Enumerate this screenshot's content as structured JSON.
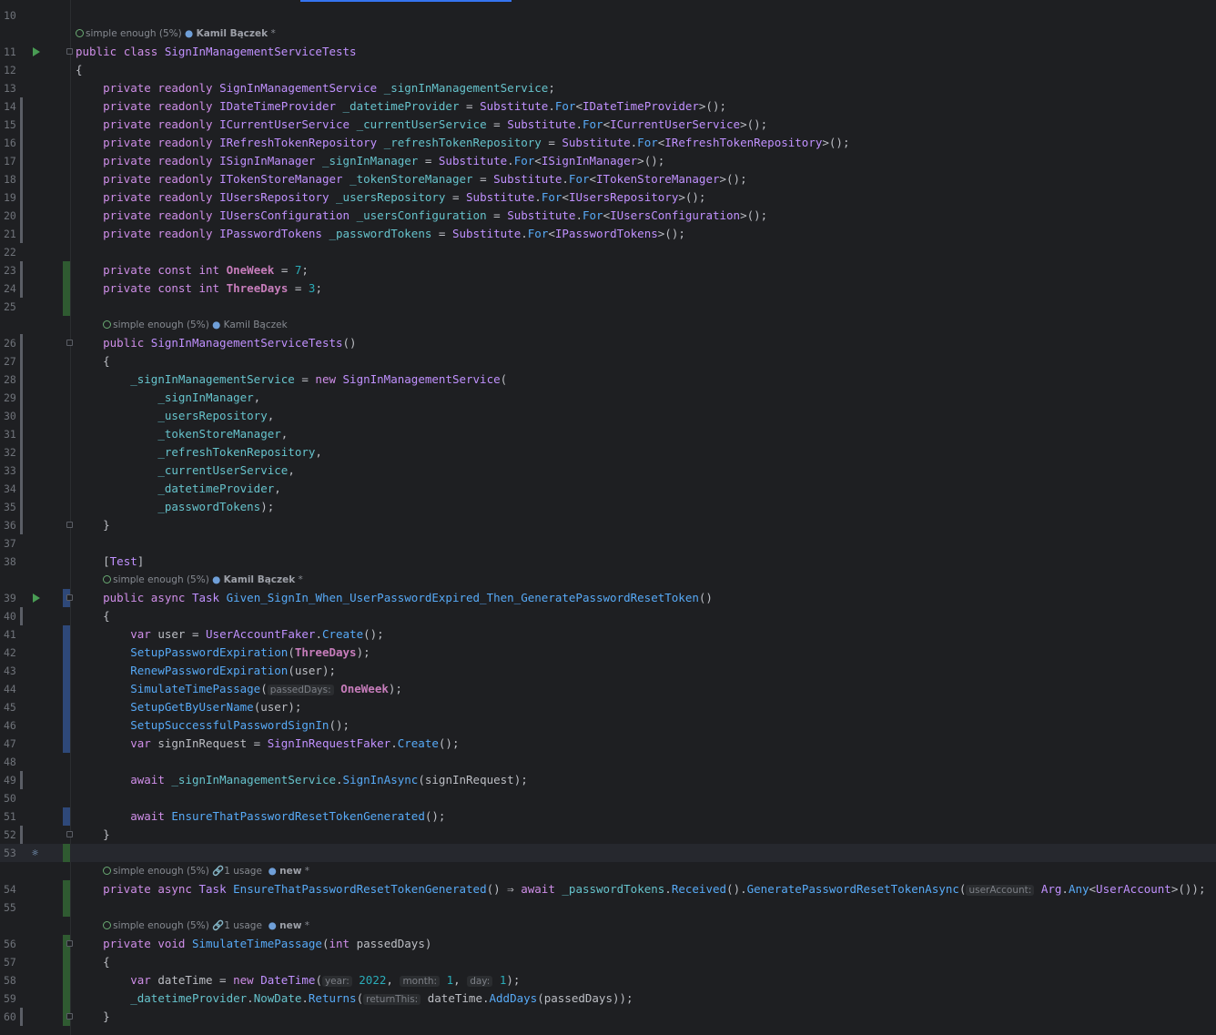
{
  "hints": {
    "complexity": "simple enough (5%)",
    "author": "Kamil Bączek",
    "new_label": "new",
    "usage": "1 usage"
  },
  "lines": [
    {
      "n": "10",
      "code": ""
    },
    {
      "n": "11",
      "code": "public class SignInManagementServiceTests"
    },
    {
      "n": "12",
      "code": "{"
    },
    {
      "n": "13",
      "code": "    private readonly SignInManagementService _signInManagementService;"
    },
    {
      "n": "14",
      "code": "    private readonly IDateTimeProvider _datetimeProvider = Substitute.For<IDateTimeProvider>();"
    },
    {
      "n": "15",
      "code": "    private readonly ICurrentUserService _currentUserService = Substitute.For<ICurrentUserService>();"
    },
    {
      "n": "16",
      "code": "    private readonly IRefreshTokenRepository _refreshTokenRepository = Substitute.For<IRefreshTokenRepository>();"
    },
    {
      "n": "17",
      "code": "    private readonly ISignInManager _signInManager = Substitute.For<ISignInManager>();"
    },
    {
      "n": "18",
      "code": "    private readonly ITokenStoreManager _tokenStoreManager = Substitute.For<ITokenStoreManager>();"
    },
    {
      "n": "19",
      "code": "    private readonly IUsersRepository _usersRepository = Substitute.For<IUsersRepository>();"
    },
    {
      "n": "20",
      "code": "    private readonly IUsersConfiguration _usersConfiguration = Substitute.For<IUsersConfiguration>();"
    },
    {
      "n": "21",
      "code": "    private readonly IPasswordTokens _passwordTokens = Substitute.For<IPasswordTokens>();"
    },
    {
      "n": "22",
      "code": ""
    },
    {
      "n": "23",
      "code": "    private const int OneWeek = 7;"
    },
    {
      "n": "24",
      "code": "    private const int ThreeDays = 3;"
    },
    {
      "n": "25",
      "code": ""
    },
    {
      "n": "26",
      "code": "    public SignInManagementServiceTests()"
    },
    {
      "n": "27",
      "code": "    {"
    },
    {
      "n": "28",
      "code": "        _signInManagementService = new SignInManagementService("
    },
    {
      "n": "29",
      "code": "            _signInManager,"
    },
    {
      "n": "30",
      "code": "            _usersRepository,"
    },
    {
      "n": "31",
      "code": "            _tokenStoreManager,"
    },
    {
      "n": "32",
      "code": "            _refreshTokenRepository,"
    },
    {
      "n": "33",
      "code": "            _currentUserService,"
    },
    {
      "n": "34",
      "code": "            _datetimeProvider,"
    },
    {
      "n": "35",
      "code": "            _passwordTokens);"
    },
    {
      "n": "36",
      "code": "    }"
    },
    {
      "n": "37",
      "code": ""
    },
    {
      "n": "38",
      "code": "    [Test]"
    },
    {
      "n": "39",
      "code": "    public async Task Given_SignIn_When_UserPasswordExpired_Then_GeneratePasswordResetToken()"
    },
    {
      "n": "40",
      "code": "    {"
    },
    {
      "n": "41",
      "code": "        var user = UserAccountFaker.Create();"
    },
    {
      "n": "42",
      "code": "        SetupPasswordExpiration(ThreeDays);"
    },
    {
      "n": "43",
      "code": "        RenewPasswordExpiration(user);"
    },
    {
      "n": "44",
      "code": "        SimulateTimePassage(passedDays: OneWeek);"
    },
    {
      "n": "45",
      "code": "        SetupGetByUserName(user);"
    },
    {
      "n": "46",
      "code": "        SetupSuccessfulPasswordSignIn();"
    },
    {
      "n": "47",
      "code": "        var signInRequest = SignInRequestFaker.Create();"
    },
    {
      "n": "48",
      "code": ""
    },
    {
      "n": "49",
      "code": "        await _signInManagementService.SignInAsync(signInRequest);"
    },
    {
      "n": "50",
      "code": ""
    },
    {
      "n": "51",
      "code": "        await EnsureThatPasswordResetTokenGenerated();"
    },
    {
      "n": "52",
      "code": "    }"
    },
    {
      "n": "53",
      "code": ""
    },
    {
      "n": "54",
      "code": "    private async Task EnsureThatPasswordResetTokenGenerated() ⇒ await _passwordTokens.Received().GeneratePasswordResetTokenAsync(userAccount: Arg.Any<UserAccount>());"
    },
    {
      "n": "55",
      "code": ""
    },
    {
      "n": "56",
      "code": "    private void SimulateTimePassage(int passedDays)"
    },
    {
      "n": "57",
      "code": "    {"
    },
    {
      "n": "58",
      "code": "        var dateTime = new DateTime(year: 2022, month: 1, day: 1);"
    },
    {
      "n": "59",
      "code": "        _datetimeProvider.NowDate.Returns(returnThis: dateTime.AddDays(passedDays));"
    },
    {
      "n": "60",
      "code": "    }"
    }
  ]
}
